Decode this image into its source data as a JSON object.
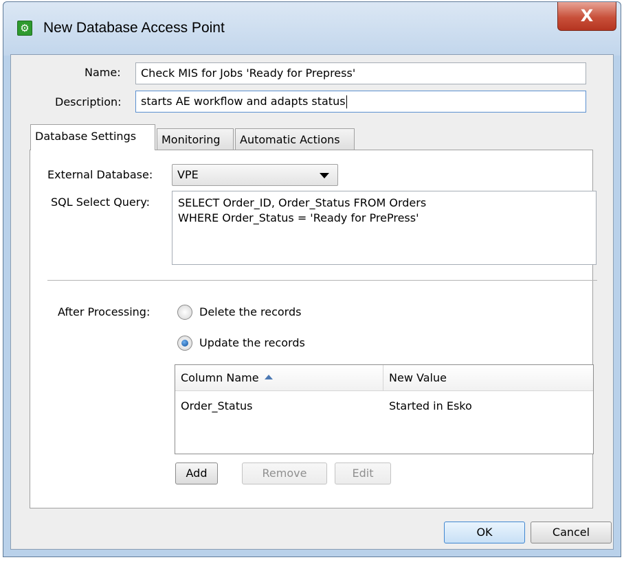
{
  "window": {
    "title": "New Database Access Point",
    "close_glyph": "X",
    "app_icon": "gear-icon"
  },
  "form": {
    "name_label": "Name:",
    "name_value": "Check MIS for Jobs 'Ready for Prepress'",
    "description_label": "Description:",
    "description_value": "starts AE workflow and adapts status"
  },
  "tabs": [
    {
      "label": "Database Settings",
      "selected": true
    },
    {
      "label": "Monitoring",
      "selected": false
    },
    {
      "label": "Automatic Actions",
      "selected": false
    }
  ],
  "database_settings": {
    "external_db_label": "External Database:",
    "external_db_value": "VPE",
    "sql_label": "SQL Select Query:",
    "sql_value": "SELECT Order_ID, Order_Status FROM Orders\nWHERE Order_Status = 'Ready for PrePress'",
    "after_processing_label": "After Processing:",
    "radio_delete_label": "Delete the records",
    "radio_update_label": "Update the records",
    "selected_radio": "update",
    "table": {
      "columns": [
        "Column Name",
        "New Value"
      ],
      "sorted_column": "Column Name",
      "rows": [
        [
          "Order_Status",
          "Started in Esko"
        ]
      ]
    },
    "buttons": {
      "add": "Add",
      "remove": "Remove",
      "edit": "Edit"
    }
  },
  "footer": {
    "ok": "OK",
    "cancel": "Cancel"
  },
  "colors": {
    "title_bar": "#c2d6ec",
    "close_button": "#c8503a",
    "accent": "#3f86d0"
  }
}
